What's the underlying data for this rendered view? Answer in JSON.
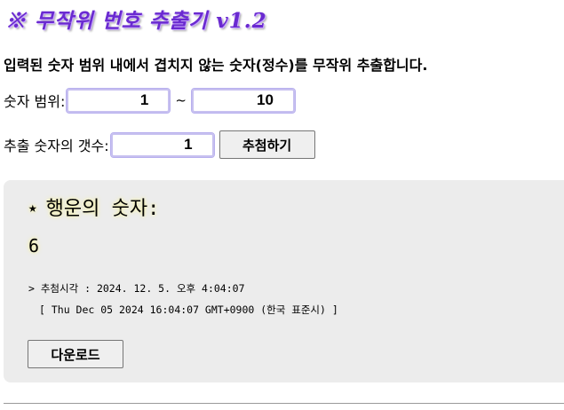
{
  "header": {
    "title": "※ 무작위 번호 추출기 v1.2",
    "description": "입력된 숫자 범위 내에서 겹치지 않는 숫자(정수)를 무작위 추출합니다."
  },
  "form": {
    "range_label": "숫자 범위:",
    "range_min": "1",
    "range_separator": "~",
    "range_max": "10",
    "count_label": "추출 숫자의 갯수:",
    "count": "1",
    "draw_button": "추첨하기"
  },
  "result": {
    "star": "★",
    "heading": "행운의 숫자:",
    "numbers": "6",
    "draw_time": "> 추첨시각 : 2024. 12. 5. 오후 4:04:07",
    "draw_time_full": "[ Thu Dec 05 2024 16:04:07 GMT+0900 (한국 표준시) ]",
    "download_button": "다운로드"
  },
  "colors": {
    "title": "#6a2ad0",
    "panel_background": "#ececec",
    "input_border": "#c7c0f0"
  }
}
